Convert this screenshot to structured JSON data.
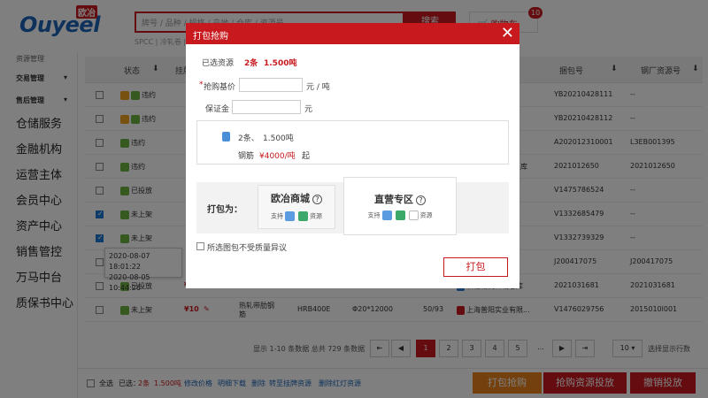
{
  "header": {
    "logo": "Ouyeel",
    "logo_cn": "欧冶",
    "search_placeholder": "牌号 / 品种 / 规格 / 产地 / 仓库 / 资源号",
    "search_button": "搜索",
    "cart_label": "购物车",
    "cart_count": "10",
    "hot_words": "SPCC | 冷轧卷 | 热轧卷"
  },
  "sidebar": {
    "sections": [
      {
        "label": "交易管理",
        "arrow": "▾"
      },
      {
        "label": "售后管理",
        "arrow": "▾"
      }
    ],
    "items": [
      "仓储服务",
      "金融机构",
      "运营主体",
      "会员中心",
      "资产中心",
      "销售管控",
      "万马中台",
      "质保书中心"
    ],
    "top_label": "资源管理"
  },
  "table": {
    "headers": {
      "status": "状态",
      "price": "挂牌价",
      "package_no": "捆包号",
      "mill_no": "钢厂资源号",
      "sort_icon": "⬇"
    },
    "rows": [
      {
        "checked": false,
        "status": "违约",
        "has_warn": true,
        "price": "",
        "package": "YB20210428111",
        "mill": "--",
        "loc": ""
      },
      {
        "checked": false,
        "status": "违约",
        "has_warn": true,
        "price": "",
        "package": "YB20210428112",
        "mill": "--",
        "loc": ""
      },
      {
        "checked": false,
        "status": "违约",
        "has_warn": false,
        "price": "",
        "package": "A202012310001",
        "mill": "L3EB001395",
        "loc": ""
      },
      {
        "checked": false,
        "status": "违约",
        "has_warn": false,
        "price": "",
        "package": "2021012650",
        "mill": "2021012650",
        "loc": "库"
      },
      {
        "checked": false,
        "status": "已投放",
        "has_warn": false,
        "price": "",
        "package": "V1475786524",
        "mill": "--",
        "loc": ""
      },
      {
        "checked": true,
        "status": "未上架",
        "has_warn": false,
        "price": "",
        "package": "V1332685479",
        "mill": "--",
        "loc": ""
      },
      {
        "checked": true,
        "status": "未上架",
        "has_warn": false,
        "price": "",
        "package": "V1332739329",
        "mill": "--",
        "loc": ""
      },
      {
        "checked": false,
        "status": "",
        "has_warn": false,
        "price": "",
        "package": "J200417075",
        "mill": "J200417075",
        "loc": ""
      },
      {
        "checked": false,
        "status": "已投放",
        "has_warn": false,
        "price": "¥5555",
        "product": "冷轧板卷",
        "grade": "SPHC",
        "spec": "0.21*730*22",
        "qty": "1/2",
        "loc": "浙江物流新城仓库",
        "package": "2021031681",
        "mill": "2021031681"
      },
      {
        "checked": false,
        "status": "未上架",
        "has_warn": false,
        "price": "¥10",
        "product": "热轧带肋钢筋",
        "grade": "HRB400E",
        "spec": "Φ20*12000",
        "qty": "50/93",
        "loc": "上海普阳实业有限...",
        "package": "V1476029756",
        "mill": "2015010l001"
      }
    ]
  },
  "tooltip": {
    "line1": "2020-08-07 18:01:22",
    "line2": "2020-08-05 10:44:26"
  },
  "pager": {
    "summary": "显示 1-10 条数据 总共 729 条数据",
    "pages": [
      "1",
      "2",
      "3",
      "4",
      "5",
      "..."
    ],
    "current": "1",
    "first": "⇤",
    "prev": "◀",
    "next": "▶",
    "last": "⇥",
    "page_size": "10",
    "page_size_label": "选择显示行数"
  },
  "bottom": {
    "select_all": "全选",
    "selected_prefix": "已选：",
    "selected_count": "2条",
    "selected_weight": "1.500吨",
    "links": [
      "修改价格",
      "明细下载",
      "删除",
      "转至挂牌资源",
      "删除红灯资源"
    ],
    "buttons": [
      "打包抢购",
      "抢购资源投放",
      "撤销投放"
    ]
  },
  "modal": {
    "title": "打包抢购",
    "close": "✕",
    "selected_label": "已选资源",
    "selected_count": "2条",
    "selected_weight": "1.500吨",
    "base_price_label": "抢购基价",
    "required_mark": "*",
    "base_price_unit": "元 / 吨",
    "deposit_label": "保证金",
    "deposit_unit": "元",
    "summary_count": "2条、",
    "summary_weight": "1.500吨",
    "summary_product": "钢筋",
    "summary_price": "¥4000/吨",
    "summary_suffix": "起",
    "pack_label": "打包为：",
    "option_a_title": "欧冶商城",
    "option_b_title": "直营专区",
    "support": "支持",
    "resource": "资源",
    "help": "?",
    "quality_label": "所选图包不受质量异议",
    "submit": "打包"
  },
  "colors": {
    "brand_red": "#c8191e",
    "brand_blue": "#1d64b6",
    "orange": "#e8801a"
  }
}
